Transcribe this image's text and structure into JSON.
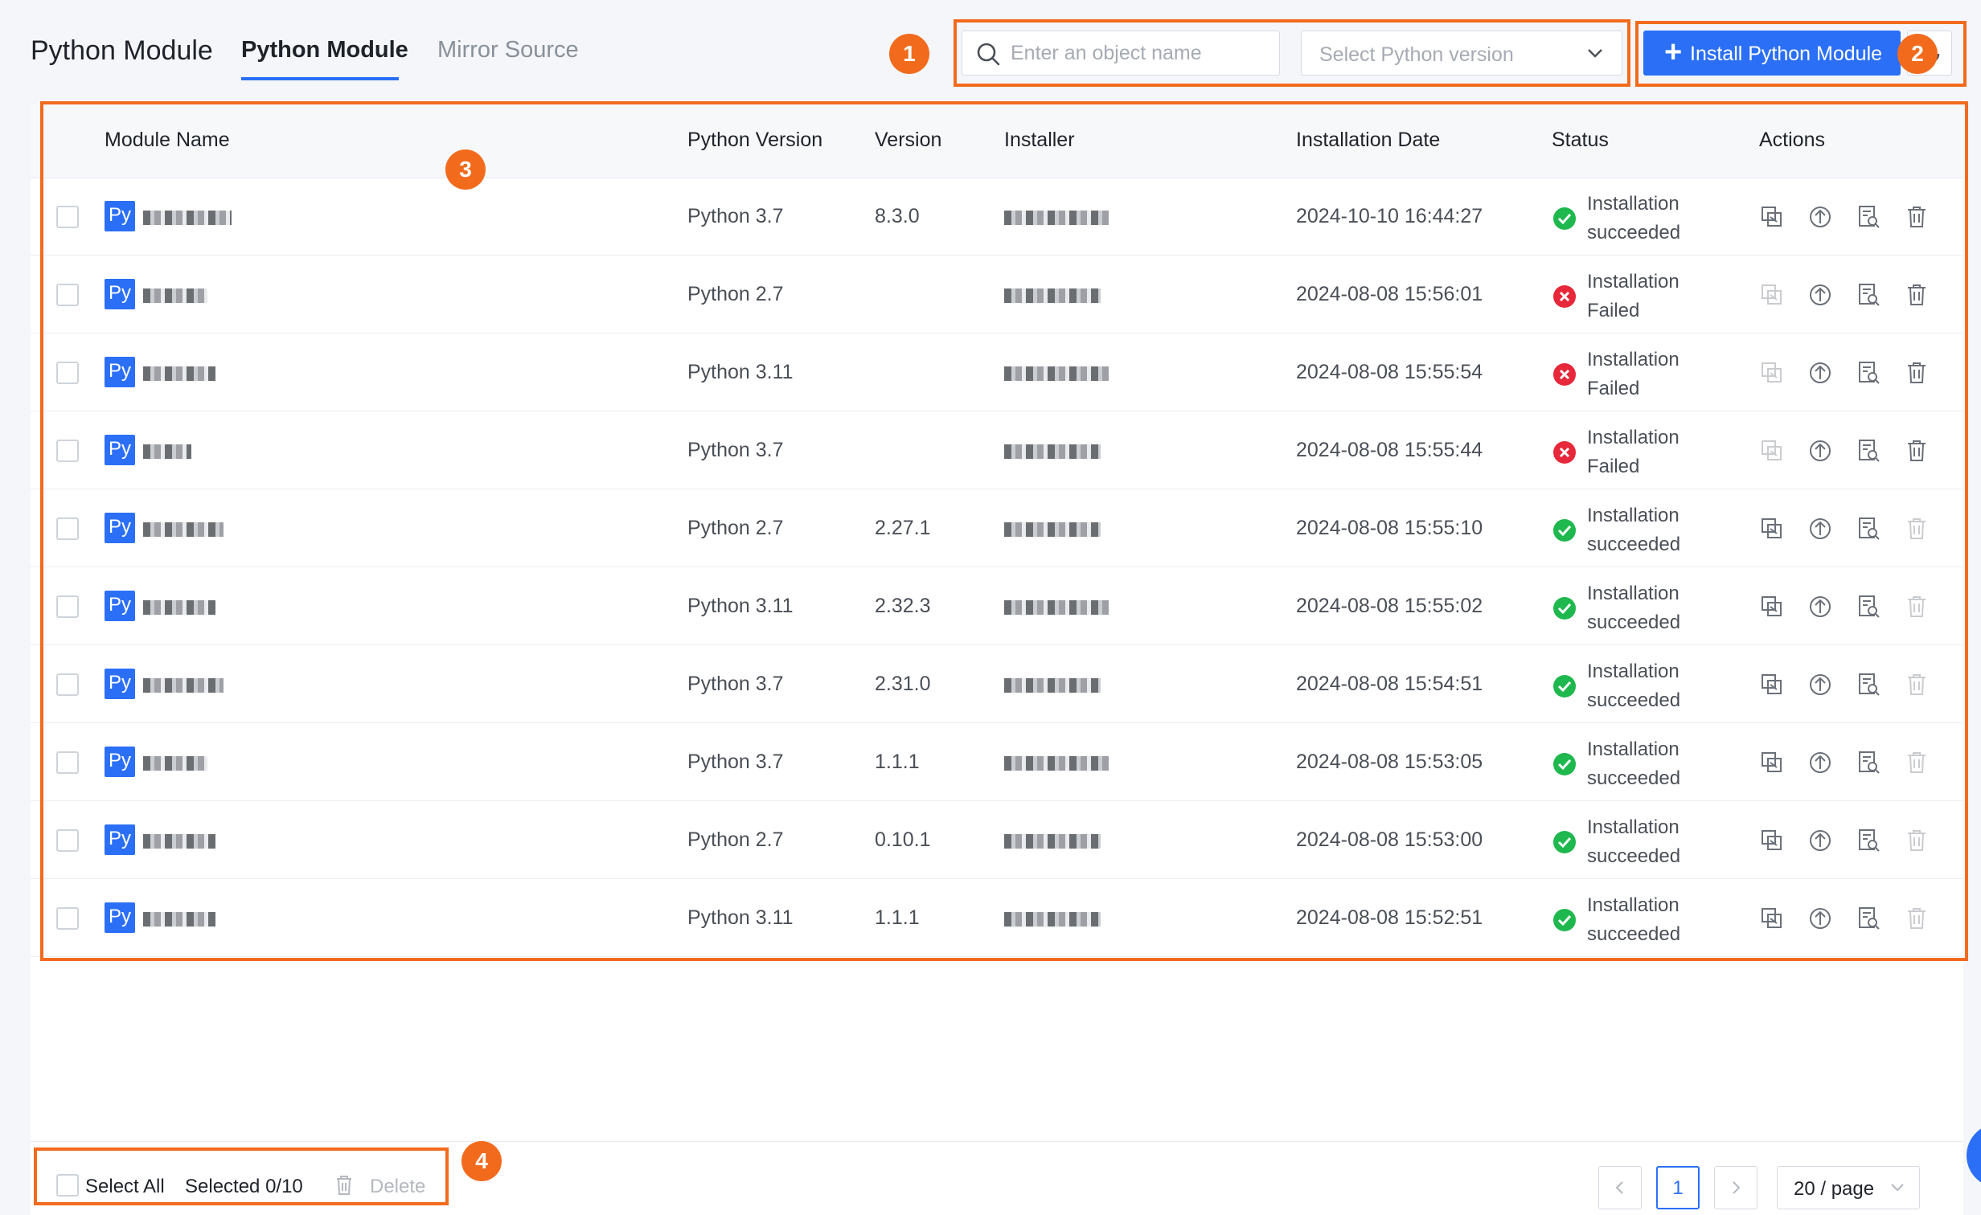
{
  "header": {
    "title": "Python Module",
    "tabs": [
      {
        "label": "Python Module",
        "active": true
      },
      {
        "label": "Mirror Source",
        "active": false
      }
    ],
    "search": {
      "placeholder": "Enter an object name",
      "value": ""
    },
    "version_select": {
      "placeholder": "Select Python version"
    },
    "install_button": "Install Python Module",
    "refresh_icon": "refresh-icon"
  },
  "callouts": [
    "1",
    "2",
    "3",
    "4"
  ],
  "table": {
    "columns": [
      "Module Name",
      "Python Version",
      "Version",
      "Installer",
      "Installation Date",
      "Status",
      "Actions"
    ],
    "module_badge": "Py",
    "rows": [
      {
        "python": "Python 3.7",
        "version": "8.3.0",
        "date": "2024-10-10 16:44:27",
        "status_line1": "Installation",
        "status_line2": "succeeded",
        "state": "success"
      },
      {
        "python": "Python 2.7",
        "version": "",
        "date": "2024-08-08 15:56:01",
        "status_line1": "Installation",
        "status_line2": "Failed",
        "state": "failed"
      },
      {
        "python": "Python 3.11",
        "version": "",
        "date": "2024-08-08 15:55:54",
        "status_line1": "Installation",
        "status_line2": "Failed",
        "state": "failed"
      },
      {
        "python": "Python 3.7",
        "version": "",
        "date": "2024-08-08 15:55:44",
        "status_line1": "Installation",
        "status_line2": "Failed",
        "state": "failed"
      },
      {
        "python": "Python 2.7",
        "version": "2.27.1",
        "date": "2024-08-08 15:55:10",
        "status_line1": "Installation",
        "status_line2": "succeeded",
        "state": "success"
      },
      {
        "python": "Python 3.11",
        "version": "2.32.3",
        "date": "2024-08-08 15:55:02",
        "status_line1": "Installation",
        "status_line2": "succeeded",
        "state": "success"
      },
      {
        "python": "Python 3.7",
        "version": "2.31.0",
        "date": "2024-08-08 15:54:51",
        "status_line1": "Installation",
        "status_line2": "succeeded",
        "state": "success"
      },
      {
        "python": "Python 3.7",
        "version": "1.1.1",
        "date": "2024-08-08 15:53:05",
        "status_line1": "Installation",
        "status_line2": "succeeded",
        "state": "success"
      },
      {
        "python": "Python 2.7",
        "version": "0.10.1",
        "date": "2024-08-08 15:53:00",
        "status_line1": "Installation",
        "status_line2": "succeeded",
        "state": "success"
      },
      {
        "python": "Python 3.11",
        "version": "1.1.1",
        "date": "2024-08-08 15:52:51",
        "status_line1": "Installation",
        "status_line2": "succeeded",
        "state": "success"
      }
    ],
    "action_icons": [
      "copy-icon",
      "upgrade-icon",
      "view-log-icon",
      "delete-icon"
    ]
  },
  "footer": {
    "select_all": "Select All",
    "selected_count": "Selected 0/10",
    "delete": "Delete",
    "page": "1",
    "page_size": "20 / page"
  },
  "colors": {
    "accent": "#2b6ff7",
    "callout": "#f26b1d",
    "success": "#1fb84e",
    "failed": "#e6283a"
  }
}
